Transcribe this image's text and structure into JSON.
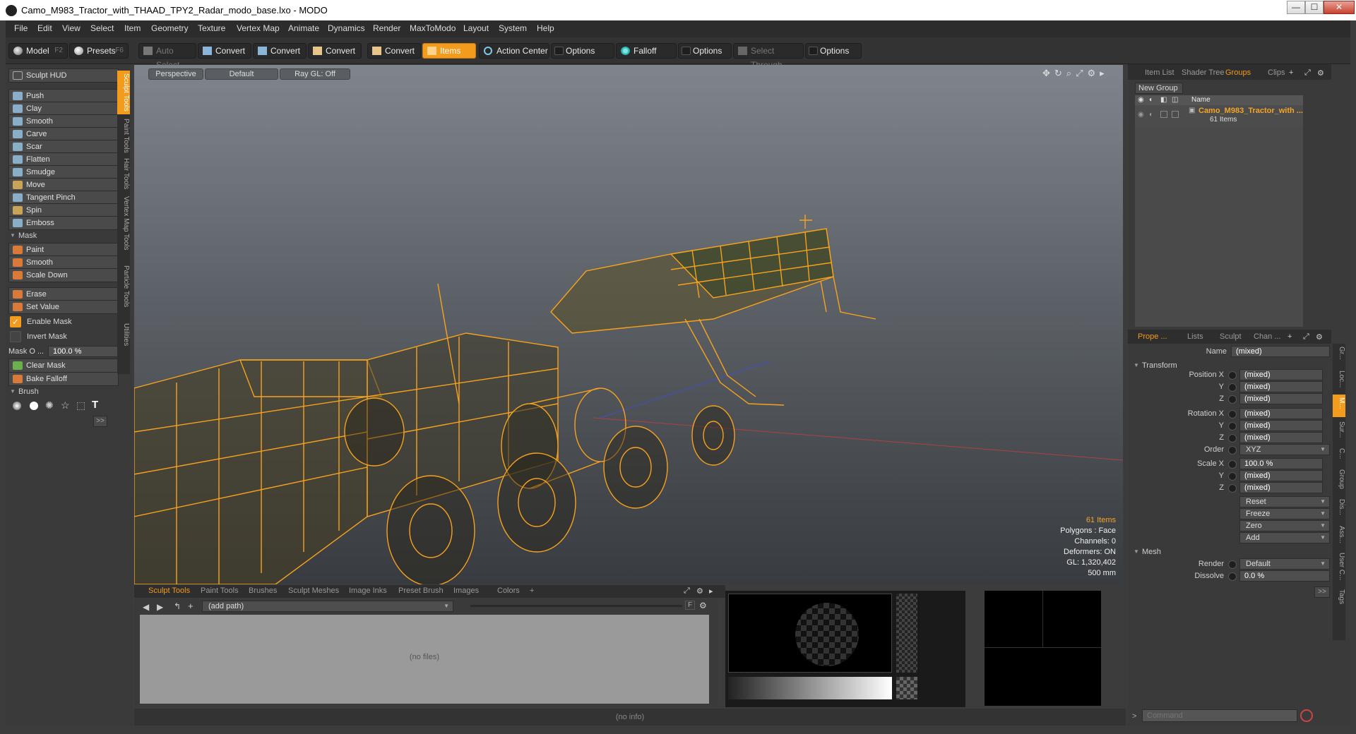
{
  "window": {
    "title": "Camo_M983_Tractor_with_THAAD_TPY2_Radar_modo_base.lxo - MODO",
    "minimize": "—",
    "maximize": "☐",
    "close": "✕"
  },
  "menu": [
    "File",
    "Edit",
    "View",
    "Select",
    "Item",
    "Geometry",
    "Texture",
    "Vertex Map",
    "Animate",
    "Dynamics",
    "Render",
    "MaxToModo",
    "Layout",
    "System",
    "Help"
  ],
  "toolbar": {
    "model": "Model",
    "model_key": "F2",
    "presets": "Presets",
    "presets_key": "F6",
    "auto_select": "Auto Select",
    "convert1": "Convert",
    "convert2": "Convert",
    "convert3": "Convert",
    "convert4": "Convert",
    "items": "Items",
    "action_center": "Action Center",
    "options1": "Options",
    "falloff": "Falloff",
    "options2": "Options",
    "select_through": "Select Through",
    "options3": "Options"
  },
  "left": {
    "hud": "Sculpt HUD",
    "tools": [
      "Push",
      "Clay",
      "Smooth",
      "Carve",
      "Scar",
      "Flatten",
      "Smudge",
      "Move",
      "Tangent Pinch",
      "Spin",
      "Emboss"
    ],
    "mask_section": "Mask",
    "mask_tools": [
      "Paint",
      "Smooth",
      "Scale Down"
    ],
    "erase": "Erase",
    "set_value": "Set Value",
    "enable_mask": "Enable Mask",
    "invert_mask": "Invert Mask",
    "mask_opacity_label": "Mask O ...",
    "mask_opacity_value": "100.0 %",
    "clear_mask": "Clear Mask",
    "bake_falloff": "Bake Falloff",
    "brush_section": "Brush",
    "more": ">>",
    "side_tabs": [
      "Sculpt Tools",
      "Paint Tools",
      "Hair Tools",
      "Vertex Map Tools",
      "Particle Tools",
      "Utilities"
    ]
  },
  "viewport": {
    "view": "Perspective",
    "shading": "Default",
    "raygl": "Ray GL: Off",
    "info": {
      "items": "61 Items",
      "polygons": "Polygons : Face",
      "channels": "Channels: 0",
      "deformers": "Deformers: ON",
      "gl": "GL: 1,320,402",
      "scale": "500 mm"
    }
  },
  "bottom": {
    "tabs": [
      "Sculpt Tools",
      "Paint Tools",
      "Brushes",
      "Sculpt Meshes",
      "Image Inks",
      "Preset Brush",
      "Images",
      "Colors"
    ],
    "add_tab": "+",
    "path": "(add path)",
    "no_files": "(no files)",
    "status": "(no info)"
  },
  "right": {
    "top_tabs": [
      "Item List",
      "Shader Tree",
      "Groups",
      "Clips"
    ],
    "new_group": "New Group",
    "col_name": "Name",
    "group_name": "Camo_M983_Tractor_with ...",
    "group_count": "61 Items",
    "prop_tabs": [
      "Prope ...",
      "Lists",
      "Sculpt",
      "Chan ..."
    ],
    "name_label": "Name",
    "name_value": "(mixed)",
    "transform": "Transform",
    "position_label": "Position X",
    "rotation_label": "Rotation X",
    "scale_label": "Scale X",
    "y_label": "Y",
    "z_label": "Z",
    "mixed": "(mixed)",
    "order_label": "Order",
    "order_value": "XYZ",
    "scale_x_value": "100.0 %",
    "reset": "Reset",
    "freeze": "Freeze",
    "zero": "Zero",
    "add": "Add",
    "mesh": "Mesh",
    "render_label": "Render",
    "render_value": "Default",
    "dissolve_label": "Dissolve",
    "dissolve_value": "0.0 %",
    "more": ">>",
    "command_placeholder": "Command",
    "side_tabs": [
      "Gr...",
      "Loc...",
      "M...",
      "Sur...",
      "C...",
      "Group",
      "Dis...",
      "Ass...",
      "User C...",
      "Tags"
    ]
  },
  "colors": {
    "accent": "#f29b1c",
    "wireframe": "#f7a21e"
  }
}
